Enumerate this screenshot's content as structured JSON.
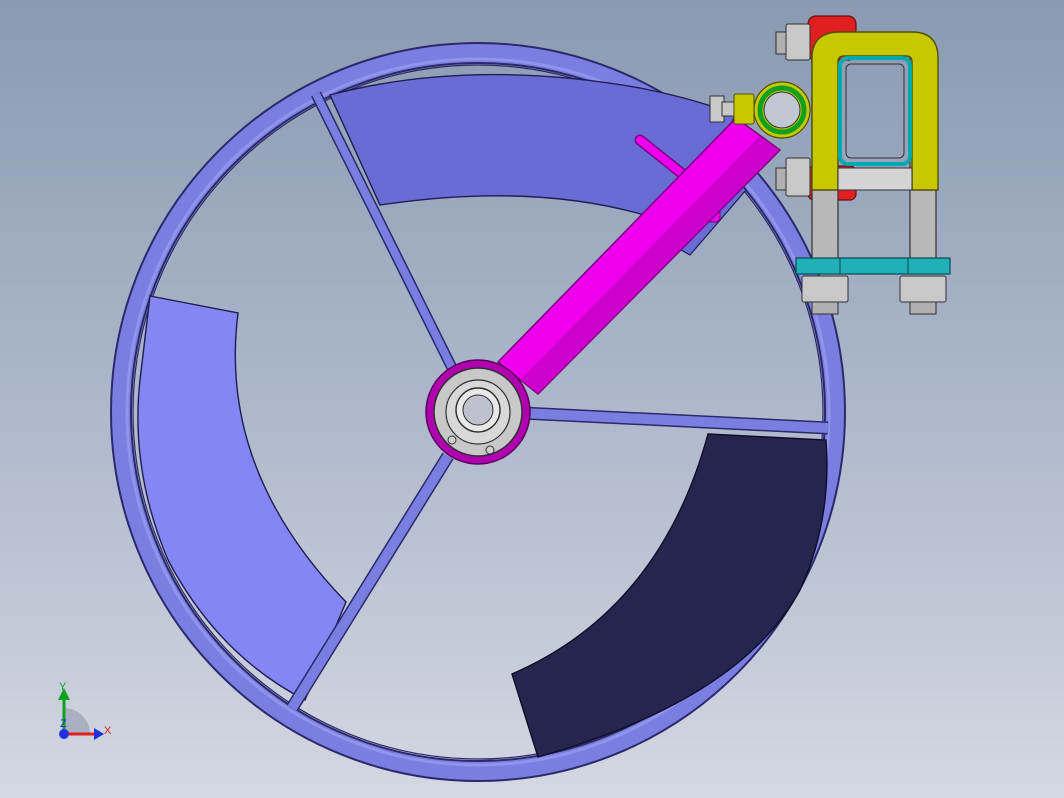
{
  "viewport": {
    "background_top": "#8a9ab2",
    "background_bottom": "#d3d8e2"
  },
  "model": {
    "wheel": {
      "rim_color": "#7a7ee0",
      "rim_outline": "#2a2a6a",
      "spoke_color": "#7a7ee0",
      "panel_colors": [
        "#6a6cd6",
        "#8486f4",
        "#25264e"
      ]
    },
    "arm": {
      "color": "#ee00ee",
      "outline": "#7a007a"
    },
    "hub": {
      "ring_color": "#b000b0",
      "bearing_color": "#d0d0d0"
    },
    "bracket": {
      "u_bolt_color": "#c8c800",
      "frame_color": "#00a8b0",
      "clamp_color": "#e02020",
      "post_color": "#b8b8b8",
      "plate_color": "#20b0b8",
      "washer_color": "#10a020"
    }
  },
  "triad": {
    "x_label": "X",
    "y_label": "Y",
    "z_label": "Z",
    "x_color": "#e02020",
    "y_color": "#10a020",
    "z_color": "#2030e0"
  }
}
